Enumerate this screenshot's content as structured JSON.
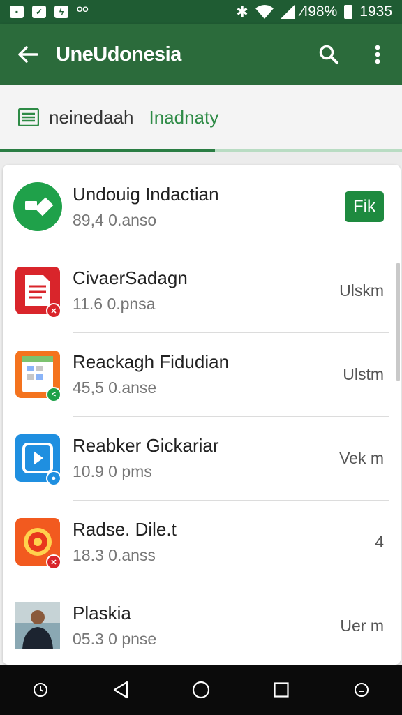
{
  "status_bar": {
    "battery": "∕I98%",
    "time": "1935"
  },
  "app_bar": {
    "title": "UneUdonesia"
  },
  "tabs": {
    "first": "neinedaah",
    "second": "Inadnaty",
    "progress": 0.535
  },
  "apps": [
    {
      "name": "Undouig Indactian",
      "size": "89,4 0.anso",
      "action": "Fik",
      "icon": "green-app-icon"
    },
    {
      "name": "CivaerSadagn",
      "size": "11.6 0.pnsa",
      "action": "Ulskm",
      "icon": "red-document-icon"
    },
    {
      "name": "Reackagh Fidudian",
      "size": "45,5 0.anse",
      "action": "Ulstm",
      "icon": "orange-grid-app-icon"
    },
    {
      "name": "Reabker Gickariar",
      "size": "10.9 0 pms",
      "action": "Vek m",
      "icon": "blue-player-icon"
    },
    {
      "name": "Radse. Dile.t",
      "size": "18.3 0.anss",
      "action": "4",
      "icon": "orange-target-icon"
    },
    {
      "name": "Plaskia",
      "size": "05.3 0 pnse",
      "action": "Uer m",
      "icon": "person-photo-thumbnail"
    }
  ],
  "colors": {
    "appbar": "#2b6b3b",
    "status": "#1f5c33",
    "accent": "#1e8a3f"
  }
}
